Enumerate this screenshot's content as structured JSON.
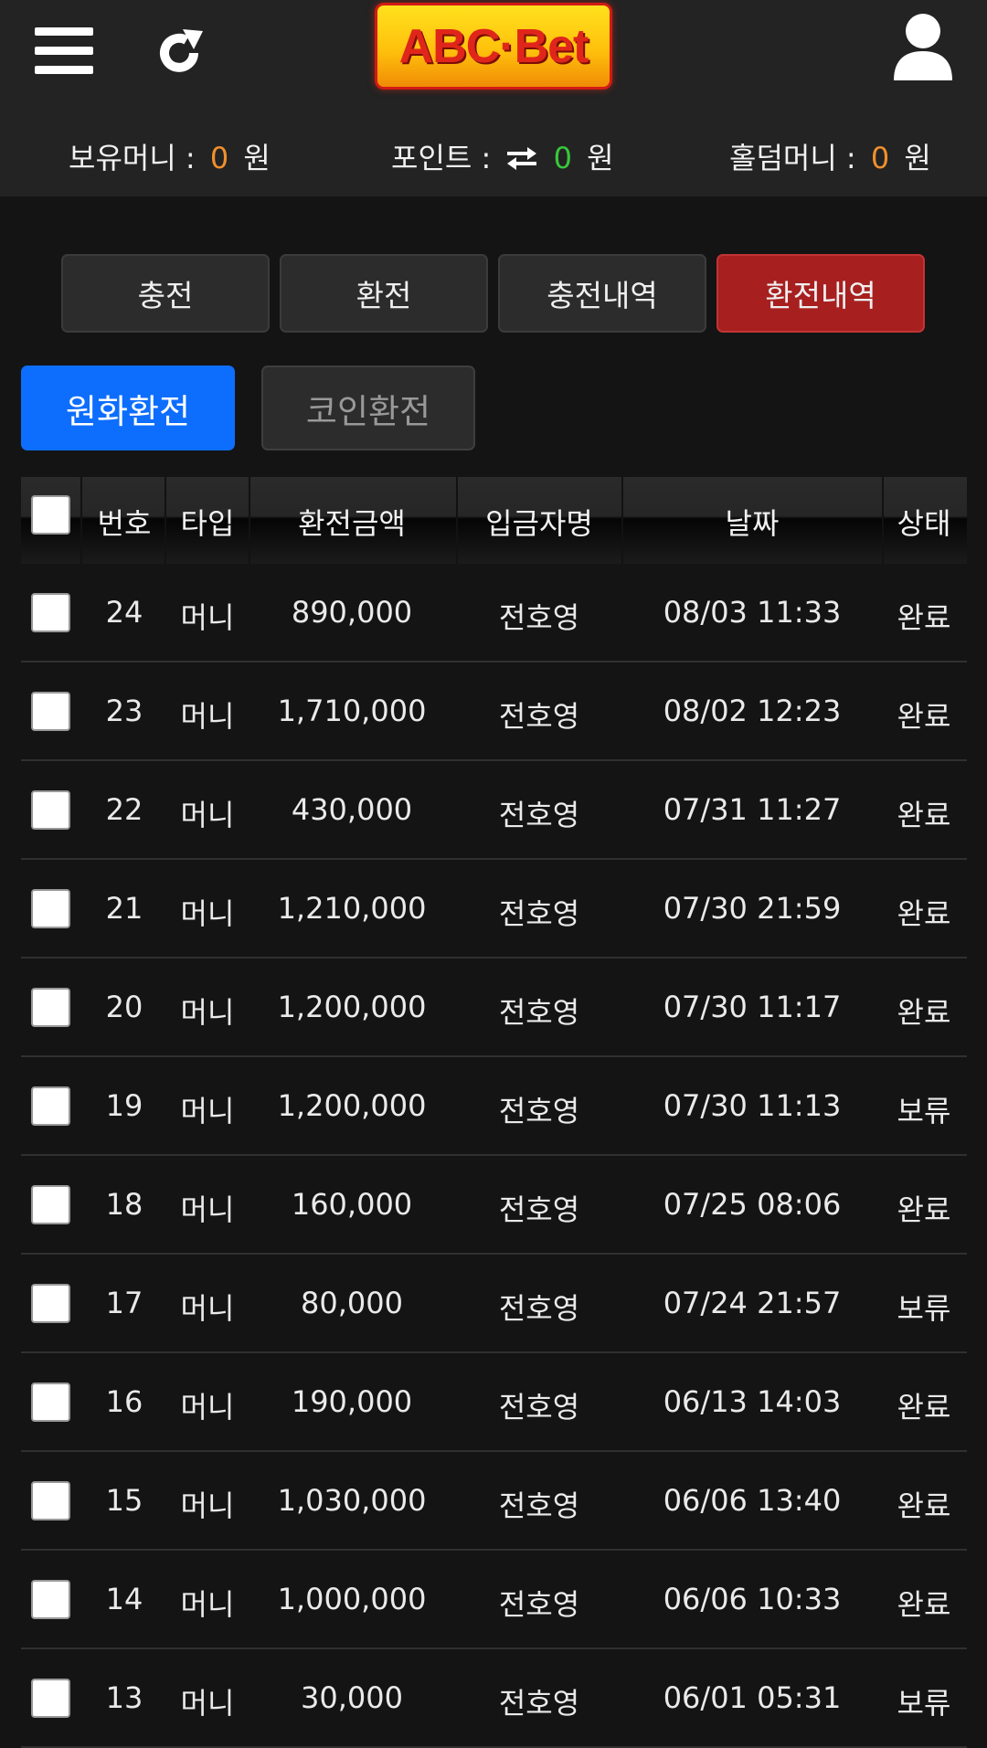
{
  "header": {
    "logo_text": "ABC·Bet",
    "menu_icon": "hamburger-menu-icon",
    "refresh_icon": "refresh-icon",
    "user_icon": "user-icon"
  },
  "balances": {
    "money_label": "보유머니 :",
    "money_value": "0",
    "point_label": "포인트 :",
    "point_value": "0",
    "holdem_label": "홀덤머니 :",
    "holdem_value": "0",
    "currency": "원"
  },
  "tabs": [
    "충전",
    "환전",
    "충전내역",
    "환전내역"
  ],
  "active_tab": "환전내역",
  "subtabs": [
    "원화환전",
    "코인환전"
  ],
  "active_subtab": "원화환전",
  "colors": {
    "active_tab": "#a71f1f",
    "active_subtab": "#0d6efd",
    "accent_orange": "#f0902c",
    "accent_green": "#38c83a"
  },
  "table": {
    "headers": [
      "번호",
      "타입",
      "환전금액",
      "입금자명",
      "날짜",
      "상태"
    ],
    "rows": [
      [
        "24",
        "머니",
        "890,000",
        "전호영",
        "08/03 11:33",
        "완료"
      ],
      [
        "23",
        "머니",
        "1,710,000",
        "전호영",
        "08/02 12:23",
        "완료"
      ],
      [
        "22",
        "머니",
        "430,000",
        "전호영",
        "07/31 11:27",
        "완료"
      ],
      [
        "21",
        "머니",
        "1,210,000",
        "전호영",
        "07/30 21:59",
        "완료"
      ],
      [
        "20",
        "머니",
        "1,200,000",
        "전호영",
        "07/30 11:17",
        "완료"
      ],
      [
        "19",
        "머니",
        "1,200,000",
        "전호영",
        "07/30 11:13",
        "보류"
      ],
      [
        "18",
        "머니",
        "160,000",
        "전호영",
        "07/25 08:06",
        "완료"
      ],
      [
        "17",
        "머니",
        "80,000",
        "전호영",
        "07/24 21:57",
        "보류"
      ],
      [
        "16",
        "머니",
        "190,000",
        "전호영",
        "06/13 14:03",
        "완료"
      ],
      [
        "15",
        "머니",
        "1,030,000",
        "전호영",
        "06/06 13:40",
        "완료"
      ],
      [
        "14",
        "머니",
        "1,000,000",
        "전호영",
        "06/06 10:33",
        "완료"
      ],
      [
        "13",
        "머니",
        "30,000",
        "전호영",
        "06/01 05:31",
        "보류"
      ]
    ]
  }
}
